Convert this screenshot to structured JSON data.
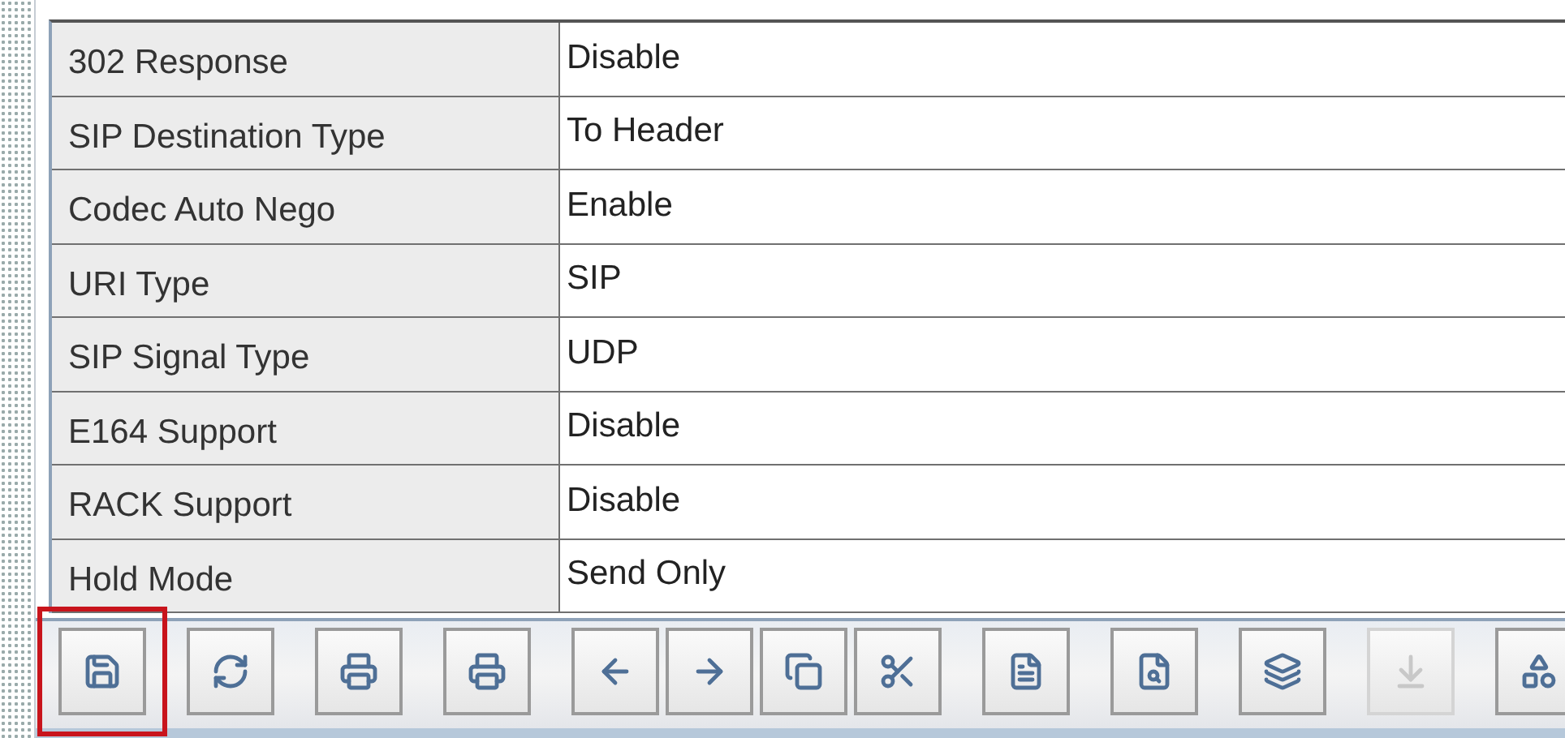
{
  "table": {
    "rows": [
      {
        "name": "302 Response",
        "value": "Disable"
      },
      {
        "name": "SIP Destination Type",
        "value": "To Header"
      },
      {
        "name": "Codec Auto Nego",
        "value": "Enable"
      },
      {
        "name": "URI Type",
        "value": "SIP"
      },
      {
        "name": "SIP Signal Type",
        "value": "UDP"
      },
      {
        "name": "E164 Support",
        "value": "Disable"
      },
      {
        "name": "RACK Support",
        "value": "Disable"
      },
      {
        "name": "Hold Mode",
        "value": "Send Only"
      }
    ]
  },
  "toolbar": {
    "groups": [
      [
        {
          "kind": "save",
          "disabled": false,
          "highlighted": true
        }
      ],
      [
        {
          "kind": "refresh",
          "disabled": false,
          "highlighted": false
        }
      ],
      [
        {
          "kind": "print",
          "disabled": false,
          "highlighted": false
        }
      ],
      [
        {
          "kind": "print",
          "disabled": false,
          "highlighted": false
        }
      ],
      [
        {
          "kind": "back",
          "disabled": false,
          "highlighted": false
        },
        {
          "kind": "forward",
          "disabled": false,
          "highlighted": false
        },
        {
          "kind": "copy",
          "disabled": false,
          "highlighted": false
        },
        {
          "kind": "cut",
          "disabled": false,
          "highlighted": false
        }
      ],
      [
        {
          "kind": "document",
          "disabled": false,
          "highlighted": false
        }
      ],
      [
        {
          "kind": "preview",
          "disabled": false,
          "highlighted": false
        }
      ],
      [
        {
          "kind": "stack",
          "disabled": false,
          "highlighted": false
        }
      ],
      [
        {
          "kind": "export",
          "disabled": true,
          "highlighted": false
        }
      ],
      [
        {
          "kind": "shapes",
          "disabled": false,
          "highlighted": false
        }
      ]
    ]
  }
}
